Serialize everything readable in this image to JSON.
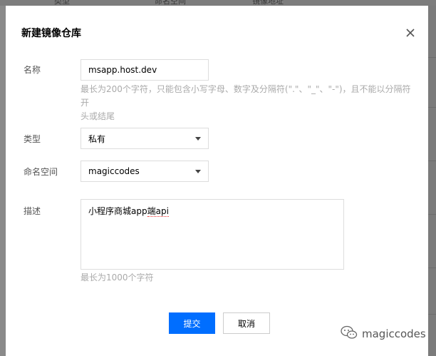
{
  "background": {
    "columns": [
      "类型",
      "命名空间",
      "镜像地址"
    ]
  },
  "dialog": {
    "title": "新建镜像仓库",
    "name": {
      "label": "名称",
      "value": "msapp.host.dev",
      "hint_line1": "最长为200个字符，只能包含小写字母、数字及分隔符(\".\"、\"_\"、\"-\")，且不能以分隔符开",
      "hint_line2": "头或结尾"
    },
    "type": {
      "label": "类型",
      "value": "私有"
    },
    "namespace": {
      "label": "命名空间",
      "value": "magiccodes"
    },
    "description": {
      "label": "描述",
      "value_prefix": "小程序商城app",
      "value_marked": "端api",
      "hint": "最长为1000个字符"
    },
    "submit_label": "提交",
    "cancel_label": "取消"
  },
  "watermark": {
    "text": "magiccodes",
    "icon": "wechat-icon"
  }
}
